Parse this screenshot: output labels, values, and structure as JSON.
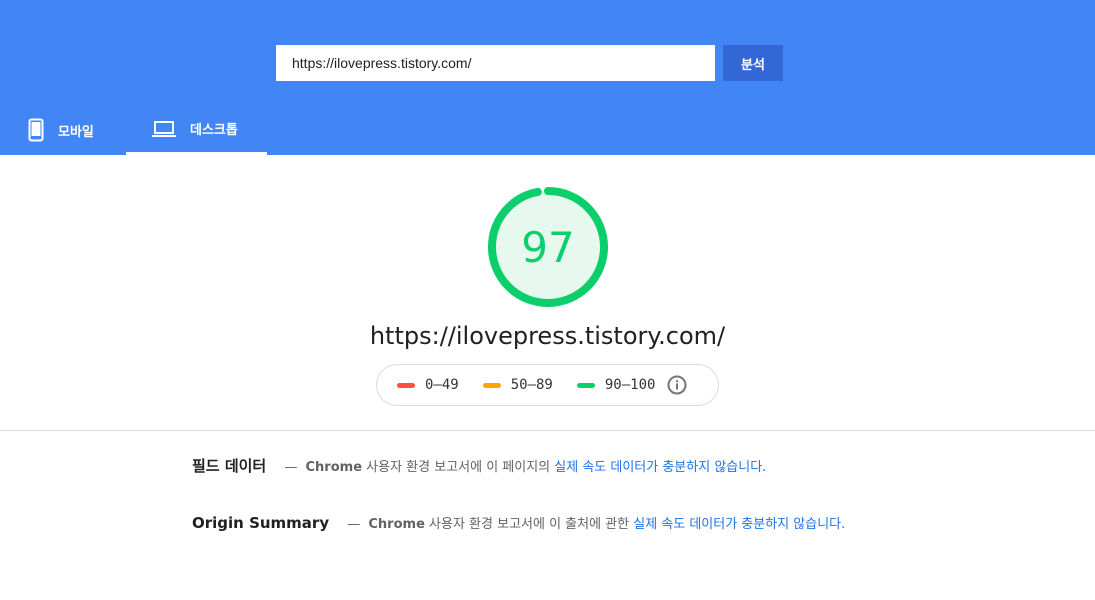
{
  "search": {
    "url_value": "https://ilovepress.tistory.com/",
    "analyze_label": "분석"
  },
  "tabs": [
    {
      "label": "모바일",
      "icon": "smartphone-icon"
    },
    {
      "label": "데스크톱",
      "icon": "laptop-icon",
      "active": true
    }
  ],
  "result": {
    "score": "97",
    "score_fraction": 0.97,
    "score_color": "#0cce6b",
    "url": "https://ilovepress.tistory.com/"
  },
  "legend": [
    {
      "range": "0–49",
      "color": "#ff4e42"
    },
    {
      "range": "50–89",
      "color": "#ffa400"
    },
    {
      "range": "90–100",
      "color": "#0cce6b"
    }
  ],
  "field_data": {
    "title": "필드 데이터",
    "dash": "—",
    "brand": "Chrome",
    "text": " 사용자 환경 보고서에 이 페이지의 ",
    "link": "실제 속도 데이터가 충분하지 않습니다",
    "end": "."
  },
  "origin_summary": {
    "title": "Origin Summary",
    "dash": "—",
    "brand": "Chrome",
    "text": " 사용자 환경 보고서에 이 출처에 관한 ",
    "link": "실제 속도 데이터가 충분하지 않습니다",
    "end": "."
  },
  "colors": {
    "header_bg": "#4285f4",
    "button_bg": "#3367d6",
    "link": "#1a73e8"
  }
}
